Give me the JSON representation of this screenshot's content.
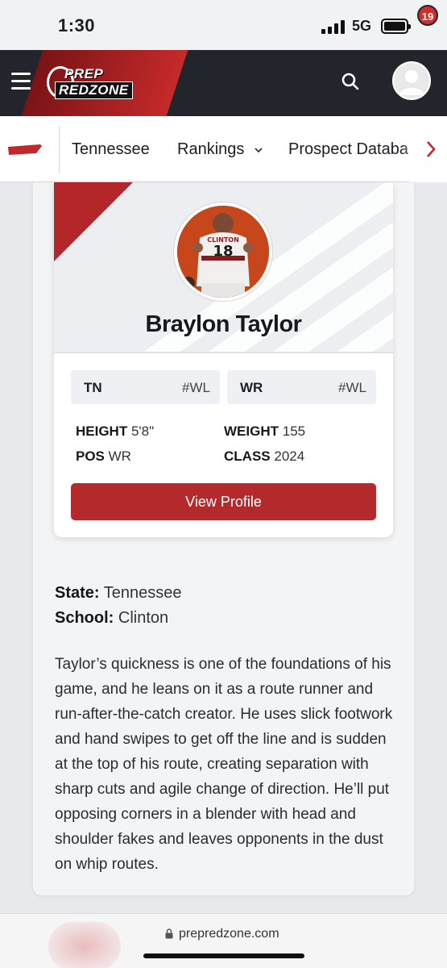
{
  "status_bar": {
    "time": "1:30",
    "network": "5G"
  },
  "header": {
    "logo_top": "PREP",
    "logo_bottom": "REDZONE",
    "notification_count": "19",
    "accent": "#c62a2a",
    "bg": "#22262c"
  },
  "nav": {
    "items": [
      {
        "label": "Tennessee"
      },
      {
        "label": "Rankings"
      },
      {
        "label": "Prospect Databa"
      }
    ]
  },
  "card": {
    "jersey_text": "CLINTON",
    "jersey_number": "18",
    "name": "Braylon Taylor",
    "tags": [
      {
        "key": "TN",
        "value": "#WL"
      },
      {
        "key": "WR",
        "value": "#WL"
      }
    ],
    "stats": {
      "height_label": "HEIGHT",
      "height": "5'8\"",
      "weight_label": "WEIGHT",
      "weight": "155",
      "pos_label": "POS",
      "pos": "WR",
      "class_label": "CLASS",
      "class": "2024"
    },
    "button": "View Profile",
    "button_color": "#b4292c"
  },
  "info": {
    "state_label": "State:",
    "state": "Tennessee",
    "school_label": "School:",
    "school": "Clinton"
  },
  "bio": "Taylor’s quickness is one of the foundations of his game, and he leans on it as a route runner and run-after-the-catch creator. He uses slick footwork and hand swipes to get off the line and is sudden at the top of his route, creating separation with sharp cuts and agile change of direction. He’ll put opposing corners in a blender with head and shoulder fakes and leaves opponents in the dust on whip routes.",
  "browser": {
    "url": "prepredzone.com"
  }
}
